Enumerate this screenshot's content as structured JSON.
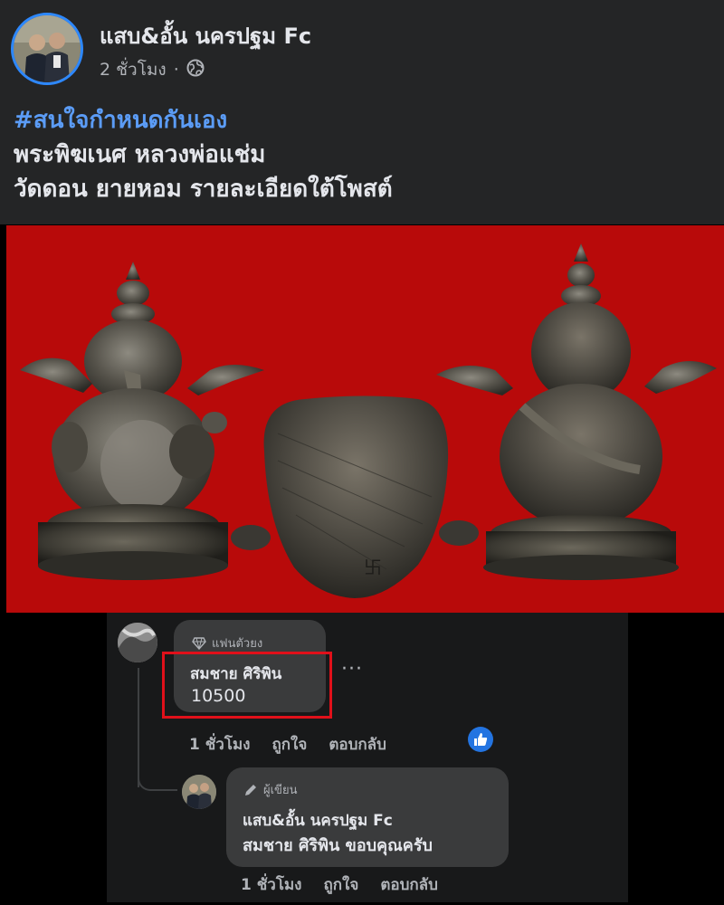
{
  "post": {
    "page_name": "แสบ&อั้น นครปฐม Fc",
    "time": "2 ชั่วโมง",
    "separator": "·",
    "hashtag": "#สนใจกำหนดกันเอง",
    "line1": "พระพิฆเนศ หลวงพ่อแช่ม",
    "line2": "วัดดอน ยายหอม รายละเอียดใต้โพสต์",
    "privacy_icon": "globe-icon"
  },
  "photo": {
    "background_color": "#b80a0a"
  },
  "comment1": {
    "badge": "แฟนตัวยง",
    "badge_icon": "diamond-icon",
    "author": "สมชาย ศิริพิน",
    "text": "10500",
    "more": "···",
    "time": "1 ชั่วโมง",
    "like": "ถูกใจ",
    "reply": "ตอบกลับ",
    "highlight_color": "#e0101a"
  },
  "reply1": {
    "badge": "ผู้เขียน",
    "badge_icon": "pencil-icon",
    "author": "แสบ&อั้น นครปฐม Fc",
    "text": "สมชาย ศิริพิน ขอบคุณครับ",
    "time": "1 ชั่วโมง",
    "like": "ถูกใจ",
    "reply": "ตอบกลับ"
  }
}
